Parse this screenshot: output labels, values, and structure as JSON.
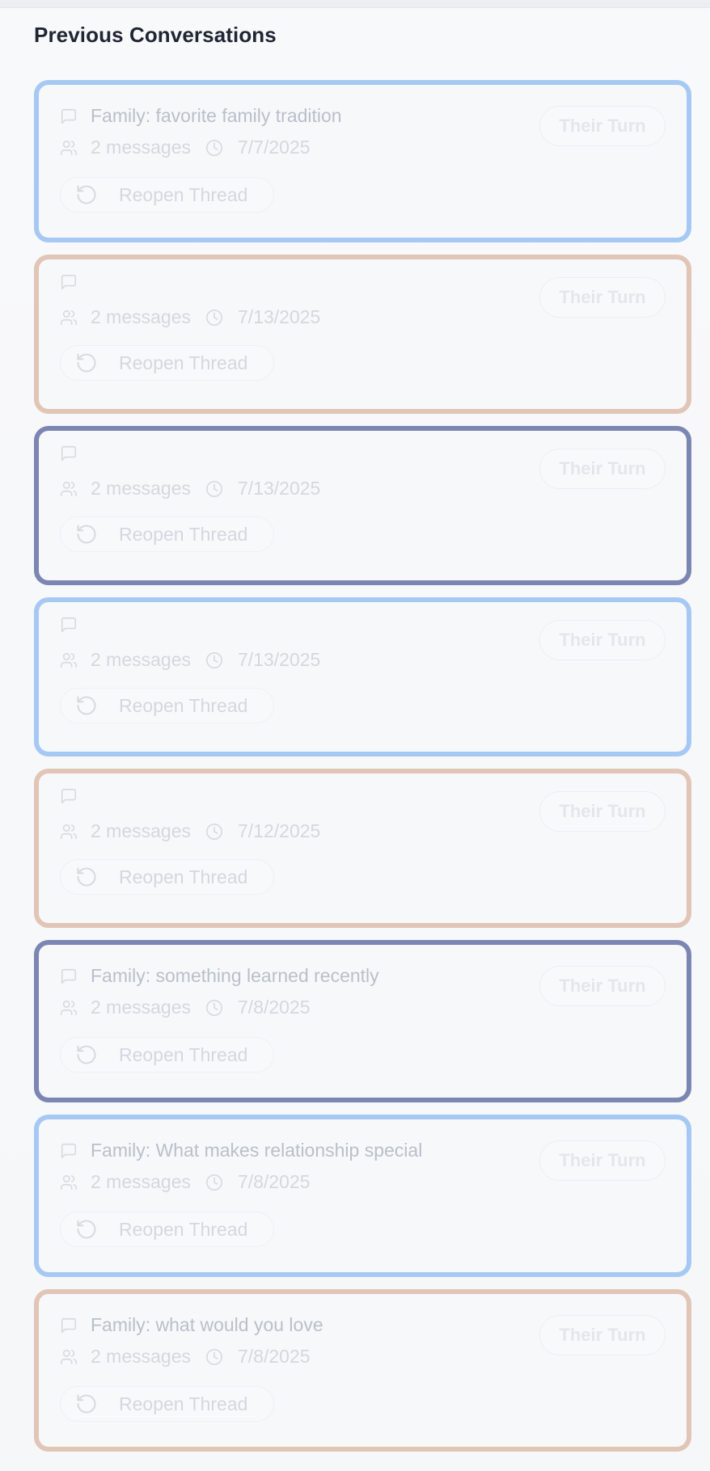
{
  "section_title": "Previous Conversations",
  "colors": {
    "blue": "#a6c9f4",
    "tan": "#e1c5b7",
    "navy": "#7b86b2"
  },
  "conversations": [
    {
      "title": "Family: favorite family tradition",
      "messages": "2 messages",
      "date": "7/7/2025",
      "status": "Their Turn",
      "action": "Reopen Thread",
      "border": "blue"
    },
    {
      "title": "",
      "messages": "2 messages",
      "date": "7/13/2025",
      "status": "Their Turn",
      "action": "Reopen Thread",
      "border": "tan"
    },
    {
      "title": "",
      "messages": "2 messages",
      "date": "7/13/2025",
      "status": "Their Turn",
      "action": "Reopen Thread",
      "border": "navy"
    },
    {
      "title": "",
      "messages": "2 messages",
      "date": "7/13/2025",
      "status": "Their Turn",
      "action": "Reopen Thread",
      "border": "blue"
    },
    {
      "title": "",
      "messages": "2 messages",
      "date": "7/12/2025",
      "status": "Their Turn",
      "action": "Reopen Thread",
      "border": "tan"
    },
    {
      "title": "Family: something learned recently",
      "messages": "2 messages",
      "date": "7/8/2025",
      "status": "Their Turn",
      "action": "Reopen Thread",
      "border": "navy"
    },
    {
      "title": "Family: What makes relationship special",
      "messages": "2 messages",
      "date": "7/8/2025",
      "status": "Their Turn",
      "action": "Reopen Thread",
      "border": "blue"
    },
    {
      "title": "Family: what would you love",
      "messages": "2 messages",
      "date": "7/8/2025",
      "status": "Their Turn",
      "action": "Reopen Thread",
      "border": "tan"
    }
  ],
  "icons": {
    "title": "message-square-icon",
    "messages": "users-icon",
    "date": "clock-icon",
    "action": "rotate-ccw-icon"
  }
}
